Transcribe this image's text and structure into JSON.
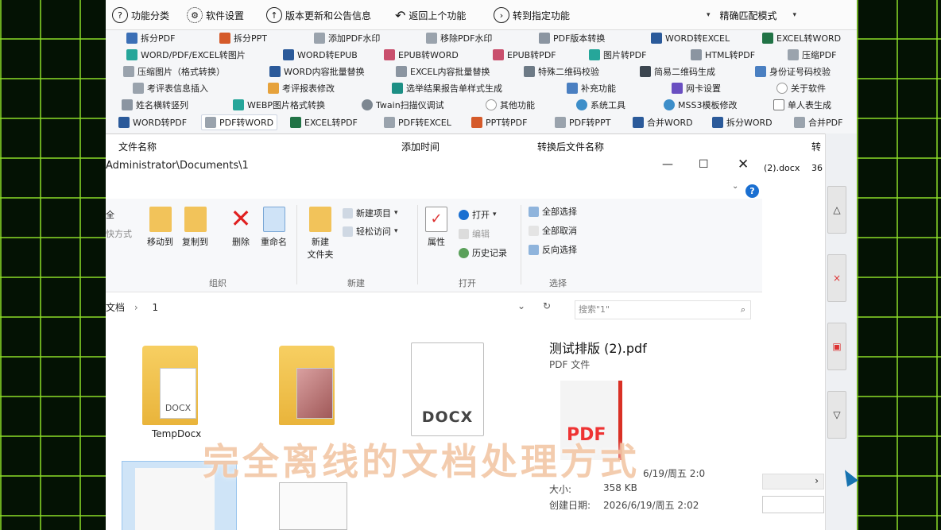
{
  "topbar": {
    "items": [
      {
        "icon": "question-icon",
        "label": "功能分类"
      },
      {
        "icon": "gear-icon",
        "label": "软件设置"
      },
      {
        "icon": "up-arrow-icon",
        "label": "版本更新和公告信息"
      },
      {
        "icon": "back-icon",
        "label": "返回上个功能"
      },
      {
        "icon": "goto-icon",
        "label": "转到指定功能"
      }
    ],
    "mode_label": "精确匹配模式"
  },
  "function_rows": [
    [
      "拆分PDF",
      "拆分PPT",
      "添加PDF水印",
      "移除PDF水印",
      "PDF版本转换",
      "WORD转EXCEL",
      "EXCEL转WORD"
    ],
    [
      "WORD/PDF/EXCEL转图片",
      "WORD转EPUB",
      "EPUB转WORD",
      "EPUB转PDF",
      "图片转PDF",
      "HTML转PDF",
      "压缩PDF"
    ],
    [
      "压缩图片（格式转换）",
      "WORD内容批量替换",
      "EXCEL内容批量替换",
      "特殊二维码校验",
      "简易二维码生成",
      "身份证号码校验"
    ],
    [
      "考评表信息插入",
      "考评报表修改",
      "选举结果报告单样式生成",
      "补充功能",
      "网卡设置",
      "关于软件"
    ],
    [
      "姓名横转竖列",
      "WEBP图片格式转换",
      "Twain扫描仪调试",
      "其他功能",
      "系统工具",
      "MSS3模板修改",
      "单人表生成"
    ],
    [
      "WORD转PDF",
      "PDF转WORD",
      "EXCEL转PDF",
      "PDF转EXCEL",
      "PPT转PDF",
      "PDF转PPT",
      "合并WORD",
      "拆分WORD",
      "合并PDF"
    ]
  ],
  "list_columns": [
    "文件名称",
    "添加时间",
    "转换后文件名称",
    "转"
  ],
  "right_cut_text": {
    "name": "(2).docx",
    "num": "36"
  },
  "explorer": {
    "path_title": "Administrator\\Documents\\1",
    "ribbon": {
      "organize": {
        "move_to": "移动到",
        "copy_to": "复制到",
        "delete": "删除",
        "rename": "重命名",
        "group": "组织"
      },
      "new": {
        "new_folder": "新建\n文件夹",
        "new_item": "新建项目",
        "easy_access": "轻松访问",
        "group": "新建"
      },
      "open": {
        "properties": "属性",
        "open": "打开",
        "edit": "编辑",
        "history": "历史记录",
        "group": "打开"
      },
      "select": {
        "select_all": "全部选择",
        "select_none": "全部取消",
        "invert": "反向选择",
        "group": "选择"
      },
      "cut_left_a": "全",
      "cut_left_b": "快方式"
    },
    "breadcrumb": [
      "文档",
      "1"
    ],
    "search_placeholder": "搜索\"1\"",
    "tiles": [
      {
        "name": "TempDocx",
        "kind": "folder",
        "badge": "DOCX"
      },
      {
        "name": "",
        "kind": "folder-photo"
      },
      {
        "name": "",
        "kind": "docx",
        "badge": "DOCX"
      }
    ],
    "preview": {
      "title": "测试排版 (2).pdf",
      "type": "PDF 文件",
      "thumb_label": "PDF",
      "size_label": "大小:",
      "size_value": "358 KB",
      "created_label": "创建日期:",
      "created_value": "2026/6/19/周五 2:02",
      "modified_partial": "6/19/周五 2:0"
    }
  },
  "caption": "完全离线的文档处理方式",
  "colors": {
    "accent": "#1a6fd1",
    "pdf_red": "#d93025",
    "folder": "#e9b43b"
  }
}
